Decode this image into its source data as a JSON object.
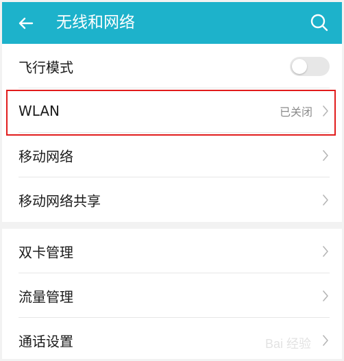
{
  "header": {
    "title": "无线和网络",
    "back_icon": "back-arrow-icon",
    "search_icon": "search-icon",
    "bar_color": "#1db2cb"
  },
  "items": [
    {
      "label": "飞行模式",
      "control": "toggle",
      "toggle_on": false
    },
    {
      "label": "WLAN",
      "status": "已关闭"
    },
    {
      "label": "移动网络",
      "highlighted": true
    },
    {
      "label": "移动网络共享"
    },
    {
      "label": "双卡管理"
    },
    {
      "label": "流量管理"
    },
    {
      "label": "通话设置"
    }
  ],
  "watermark": {
    "text": "Bai 经验"
  },
  "colors": {
    "highlight_border": "#e11b1b",
    "status_text": "#8a8a8a"
  }
}
